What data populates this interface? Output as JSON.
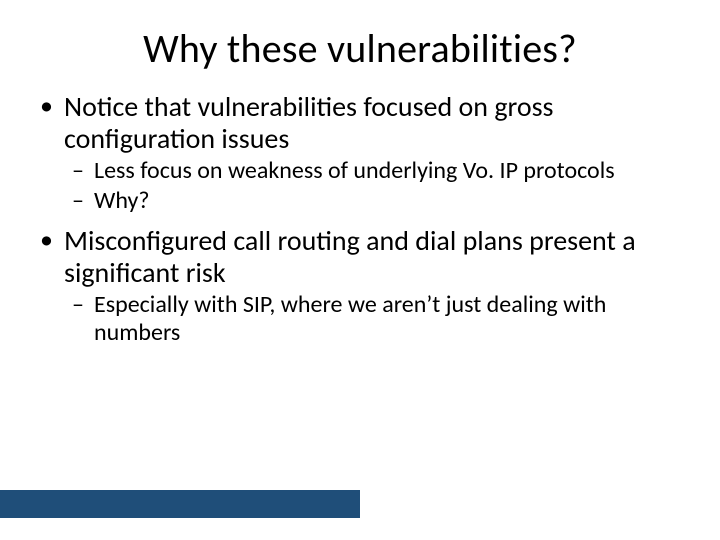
{
  "title": "Why these vulnerabilities?",
  "bullets": [
    {
      "text": "Notice that vulnerabilities focused on gross configuration issues",
      "sub": [
        "Less focus on weakness of underlying Vo. IP protocols",
        "Why?"
      ]
    },
    {
      "text": "Misconfigured call routing and dial plans present a significant risk",
      "sub": [
        "Especially with SIP, where we aren’t just dealing with numbers"
      ]
    }
  ]
}
